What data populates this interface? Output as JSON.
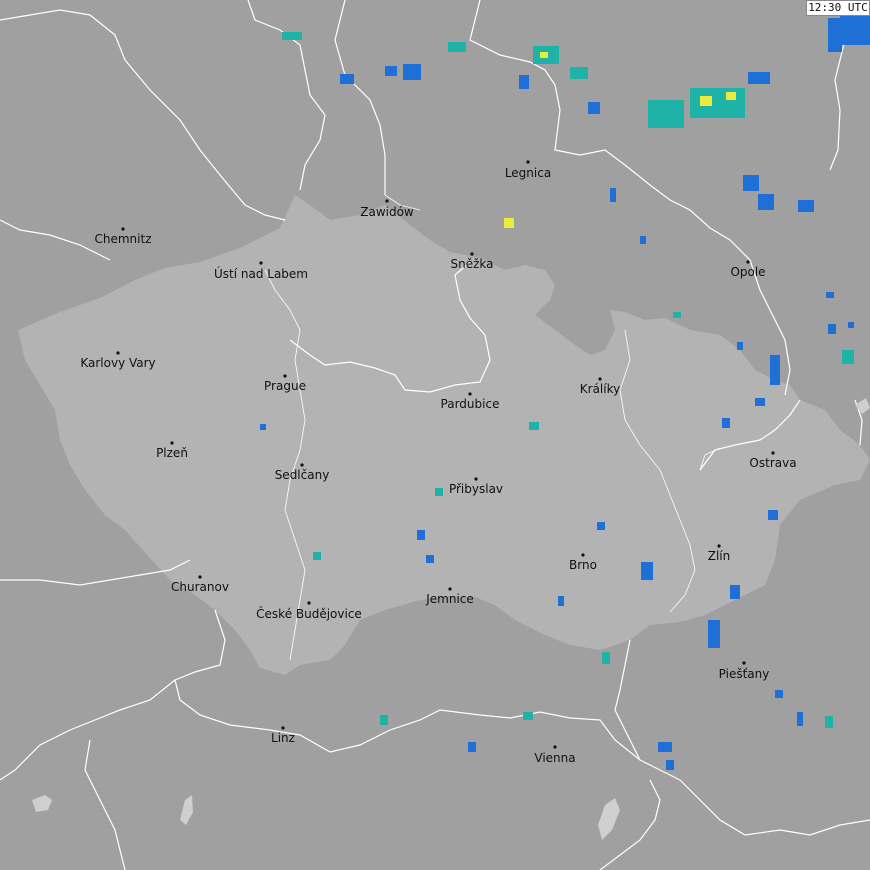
{
  "timestamp": "12:30 UTC",
  "colors": {
    "background": "#a0a0a0",
    "highlighted_region": "#b3b3b3",
    "border": "#ffffff",
    "radar_low": "#1e6fd6",
    "radar_mid": "#1fb3a8",
    "radar_high": "#e9ec3b"
  },
  "cities": [
    {
      "name": "Chemnitz",
      "id": "chemnitz"
    },
    {
      "name": "Zawidów",
      "id": "zawidow"
    },
    {
      "name": "Legnica",
      "id": "legnica"
    },
    {
      "name": "Ústí nad Labem",
      "id": "usti"
    },
    {
      "name": "Sněžka",
      "id": "snezka"
    },
    {
      "name": "Opole",
      "id": "opole"
    },
    {
      "name": "Karlovy Vary",
      "id": "karlovy-vary"
    },
    {
      "name": "Prague",
      "id": "prague"
    },
    {
      "name": "Králíky",
      "id": "kraliky"
    },
    {
      "name": "Pardubice",
      "id": "pardubice"
    },
    {
      "name": "Plzeň",
      "id": "plzen"
    },
    {
      "name": "Ostrava",
      "id": "ostrava"
    },
    {
      "name": "Sedlčany",
      "id": "sedlcany"
    },
    {
      "name": "Přibyslav",
      "id": "pribyslav"
    },
    {
      "name": "Zlín",
      "id": "zlin"
    },
    {
      "name": "Brno",
      "id": "brno"
    },
    {
      "name": "Churanov",
      "id": "churanov"
    },
    {
      "name": "Jemnice",
      "id": "jemnice"
    },
    {
      "name": "České Budějovice",
      "id": "budejovice"
    },
    {
      "name": "Piešťany",
      "id": "piestany"
    },
    {
      "name": "Linz",
      "id": "linz"
    },
    {
      "name": "Vienna",
      "id": "vienna"
    }
  ]
}
